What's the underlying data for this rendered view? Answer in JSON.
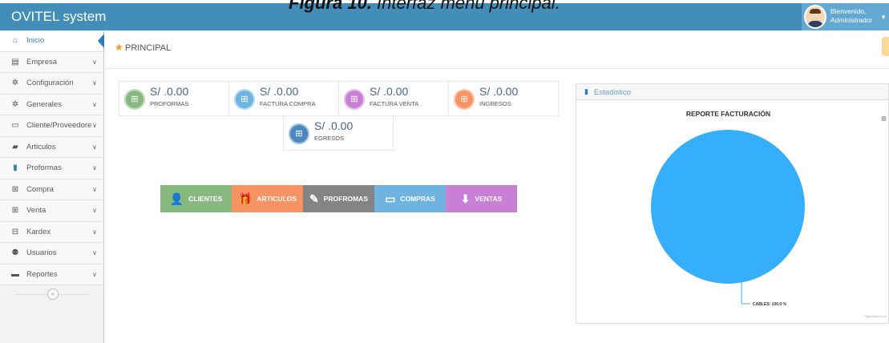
{
  "caption": {
    "prefix": "Figura 10.",
    "text": " Interfaz menú principal."
  },
  "navbar": {
    "brand": "OVITEL system",
    "welcome_line1": "Bienvenido,",
    "welcome_line2": "Administrador",
    "caret": "▼"
  },
  "sidebar": {
    "items": [
      {
        "label": "Inicio",
        "icon": "home-icon",
        "glyph": "⌂",
        "active": true
      },
      {
        "label": "Empresa",
        "icon": "building-icon",
        "glyph": "▤"
      },
      {
        "label": "Configuración",
        "icon": "gear-icon",
        "glyph": "✲"
      },
      {
        "label": "Generales",
        "icon": "cogs-icon",
        "glyph": "✲"
      },
      {
        "label": "Cliente/Proveedore",
        "icon": "desktop-icon",
        "glyph": "▭"
      },
      {
        "label": "Articulos",
        "icon": "book-icon",
        "glyph": "▰"
      },
      {
        "label": "Proformas",
        "icon": "file-icon",
        "glyph": "▮",
        "highlight": true
      },
      {
        "label": "Compra",
        "icon": "cart-icon",
        "glyph": "⊞"
      },
      {
        "label": "Venta",
        "icon": "cart-icon",
        "glyph": "⊞"
      },
      {
        "label": "Kardex",
        "icon": "tags-icon",
        "glyph": "⊟"
      },
      {
        "label": "Usuarios",
        "icon": "users-icon",
        "glyph": "⚉"
      },
      {
        "label": "Reportes",
        "icon": "inbox-icon",
        "glyph": "▬"
      }
    ],
    "collapse_glyph": "«"
  },
  "breadcrumb": {
    "label": "PRINCIPAL"
  },
  "infoboxes": [
    {
      "value": "S/ .0.00",
      "label": "PROFORMAS",
      "color": "#87b87f"
    },
    {
      "value": "S/ .0.00",
      "label": "FACTURA COMPRA",
      "color": "#6fb3e0"
    },
    {
      "value": "S/ .0.00",
      "label": "FACTURA VENTA",
      "color": "#c97fd6"
    },
    {
      "value": "S/ .0.00",
      "label": "INGRESOS",
      "color": "#f79263"
    },
    {
      "value": "S/ .0.00",
      "label": "EGRESOS",
      "color": "#4b88bd"
    }
  ],
  "actions": [
    {
      "label": "CLIENTES",
      "color": "#87b87f",
      "icon": "user-icon",
      "glyph": "👤"
    },
    {
      "label": "ARTICULOS",
      "color": "#f79263",
      "icon": "gift-icon",
      "glyph": "🎁"
    },
    {
      "label": "PROFROMAS",
      "color": "#848484",
      "icon": "edit-icon",
      "glyph": "✎"
    },
    {
      "label": "COMPRAS",
      "color": "#6fb3e0",
      "icon": "credit-card-icon",
      "glyph": "▭"
    },
    {
      "label": "VENTAS",
      "color": "#c97fd6",
      "icon": "download-icon",
      "glyph": "⬇"
    }
  ],
  "widget": {
    "title": "Estadistico",
    "icon_glyph": "▮",
    "menu_glyph": "≡"
  },
  "chart_data": {
    "type": "pie",
    "title": "REPORTE FACTURACIÓN",
    "slices": [
      {
        "name": "CABLES",
        "value": 100.0,
        "label": "CABLES: 100.0 %",
        "color": "#35aefc"
      }
    ],
    "credit": "Highcharts.com"
  }
}
